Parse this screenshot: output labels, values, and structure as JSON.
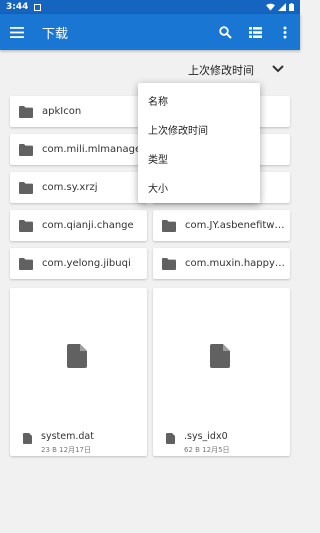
{
  "status": {
    "time": "3:44"
  },
  "appbar": {
    "title": "下载"
  },
  "sort": {
    "label": "上次修改时间"
  },
  "menu": {
    "items": [
      "名称",
      "上次修改时间",
      "类型",
      "大小"
    ]
  },
  "folders": [
    "apkIcon",
    "",
    "com.mili.mlmanager",
    "",
    "com.sy.xrzj",
    "",
    "com.qianji.change",
    "com.JY.asbenefitwal…",
    "com.yelong.jibuqi",
    "com.muxin.happysp…"
  ],
  "files": [
    {
      "name": "system.dat",
      "meta": "23 B 12月17日"
    },
    {
      "name": ".sys_idx0",
      "meta": "62 B 12月5日"
    }
  ],
  "colors": {
    "appbar": "#1976d2",
    "statusbar": "#1565c0",
    "icon": "#616161"
  }
}
